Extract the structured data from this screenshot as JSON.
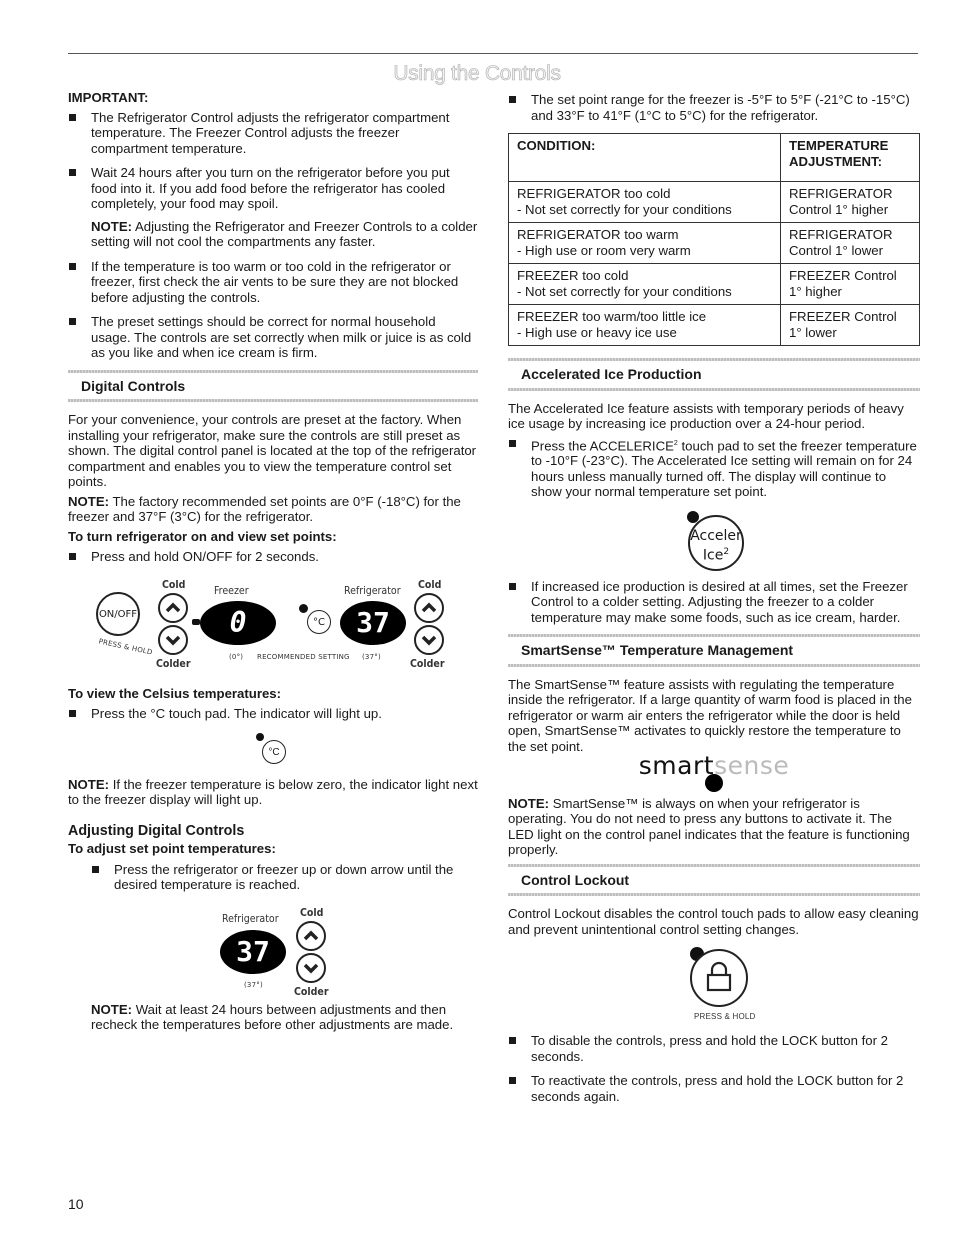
{
  "page": {
    "title": "Using the Controls",
    "page_number": "10"
  },
  "left": {
    "important_label": "IMPORTANT:",
    "important_bullets": [
      "The Refrigerator Control adjusts the refrigerator compartment temperature. The Freezer Control adjusts the freezer compartment temperature.",
      "Wait 24 hours after you turn on the refrigerator before you put food into it. If you add food before the refrigerator has cooled completely, your food may spoil."
    ],
    "note1": {
      "label": "NOTE:",
      "text": " Adjusting the Refrigerator and Freezer Controls to a colder setting will not cool the compartments any faster."
    },
    "important_bullets2": [
      "If the temperature is too warm or too cold in the refrigerator or freezer, first check the air vents to be sure they are not blocked before adjusting the controls.",
      "The preset settings should be correct for normal household usage. The controls are set correctly when milk or juice is as cold as you like and when ice cream is firm."
    ],
    "digital_controls": {
      "heading": "Digital Controls",
      "intro": "For your convenience, your controls are preset at the factory. When installing your refrigerator, make sure the controls are still preset as shown. The digital control panel is located at the top of the refrigerator compartment and enables you to view the temperature control set points.",
      "note": {
        "label": "NOTE:",
        "text": " The factory recommended set points are 0°F (-18°C) for the freezer and 37°F (3°C) for the refrigerator."
      },
      "turn_on_heading": "To turn refrigerator on and view set points:",
      "turn_on_bullet": "Press and hold ON/OFF for 2 seconds.",
      "panel": {
        "on_off_label": "ON/OFF",
        "press_hold": "PRESS & HOLD",
        "cold": "Cold",
        "colder": "Colder",
        "freezer_label": "Freezer",
        "refrigerator_label": "Refrigerator",
        "freezer_value": "0",
        "refrigerator_value": "37",
        "freezer_rec": "(0°)",
        "refrigerator_rec": "(37°)",
        "recommended": "RECOMMENDED SETTING",
        "celsius": "°C"
      },
      "celsius_heading": "To view the Celsius temperatures:",
      "celsius_bullet": "Press the °C touch pad. The indicator will light up.",
      "celsius_icon": "°C",
      "note2": {
        "label": "NOTE:",
        "text": " If the freezer temperature is below zero, the indicator light next to the freezer display will light up."
      }
    },
    "adjusting": {
      "heading": "Adjusting Digital Controls",
      "subheading": "To adjust set point temperatures:",
      "bullet": "Press the refrigerator or freezer up or down arrow until the desired temperature is reached.",
      "fig": {
        "refrigerator_label": "Refrigerator",
        "value": "37",
        "rec": "(37°)",
        "cold": "Cold",
        "colder": "Colder"
      },
      "note": {
        "label": "NOTE:",
        "text": " Wait at least 24 hours between adjustments and then recheck the temperatures before other adjustments are made."
      }
    }
  },
  "right": {
    "range_bullet": "The set point range for the freezer is -5°F to 5°F (-21°C to -15°C) and 33°F to 41°F (1°C to 5°C) for the refrigerator.",
    "table": {
      "headers": [
        "CONDITION:",
        "TEMPERATURE ADJUSTMENT:"
      ],
      "rows": [
        {
          "condition": "REFRIGERATOR too cold",
          "reason": "- Not set correctly for your conditions",
          "adj1": "REFRIGERATOR",
          "adj2": "Control 1° higher"
        },
        {
          "condition": "REFRIGERATOR too warm",
          "reason": "- High use or room very warm",
          "adj1": "REFRIGERATOR",
          "adj2": "Control 1° lower"
        },
        {
          "condition": "FREEZER too cold",
          "reason": "- Not set correctly for your conditions",
          "adj1": "FREEZER Control",
          "adj2": "1° higher"
        },
        {
          "condition": "FREEZER too warm/too little ice",
          "reason": "- High use or heavy ice use",
          "adj1": "FREEZER Control",
          "adj2": "1° lower"
        }
      ]
    },
    "accel": {
      "heading": "Accelerated Ice Production",
      "intro": "The Accelerated Ice feature assists with temporary periods of heavy ice usage by increasing ice production over a 24-hour period.",
      "bullet1_pre": "Press the ACCELERICE",
      "bullet1_sup": "2",
      "bullet1_post": " touch pad to set the freezer temperature to -10°F (-23°C). The Accelerated Ice setting will remain on for 24 hours unless manually turned off. The display will continue to show your normal temperature set point.",
      "icon_line1": "Acceler",
      "icon_line2": "Ice",
      "icon_sup": "2",
      "bullet2": "If increased ice production is desired at all times, set the Freezer Control to a colder setting. Adjusting the freezer to a colder temperature may make some foods, such as ice cream, harder."
    },
    "smartsense": {
      "heading": "SmartSense™ Temperature Management",
      "intro": "The SmartSense™ feature assists with regulating the temperature inside the refrigerator. If a large quantity of warm food is placed in the refrigerator or warm air enters the refrigerator while the door is held open, SmartSense™ activates to quickly restore the temperature to the set point.",
      "logo_part1": "smart",
      "logo_part2": "sense",
      "note": {
        "label": "NOTE:",
        "text": " SmartSense™ is always on when your refrigerator is operating. You do not need to press any buttons to activate it. The LED light on the control panel indicates that the feature is functioning properly."
      }
    },
    "lockout": {
      "heading": "Control Lockout",
      "intro": "Control Lockout disables the control touch pads to allow easy cleaning and prevent unintentional control setting changes.",
      "press_hold": "PRESS & HOLD",
      "bullets": [
        "To disable the controls, press and hold the LOCK button for 2 seconds.",
        "To reactivate the controls, press and hold the LOCK button for 2 seconds again."
      ]
    }
  }
}
